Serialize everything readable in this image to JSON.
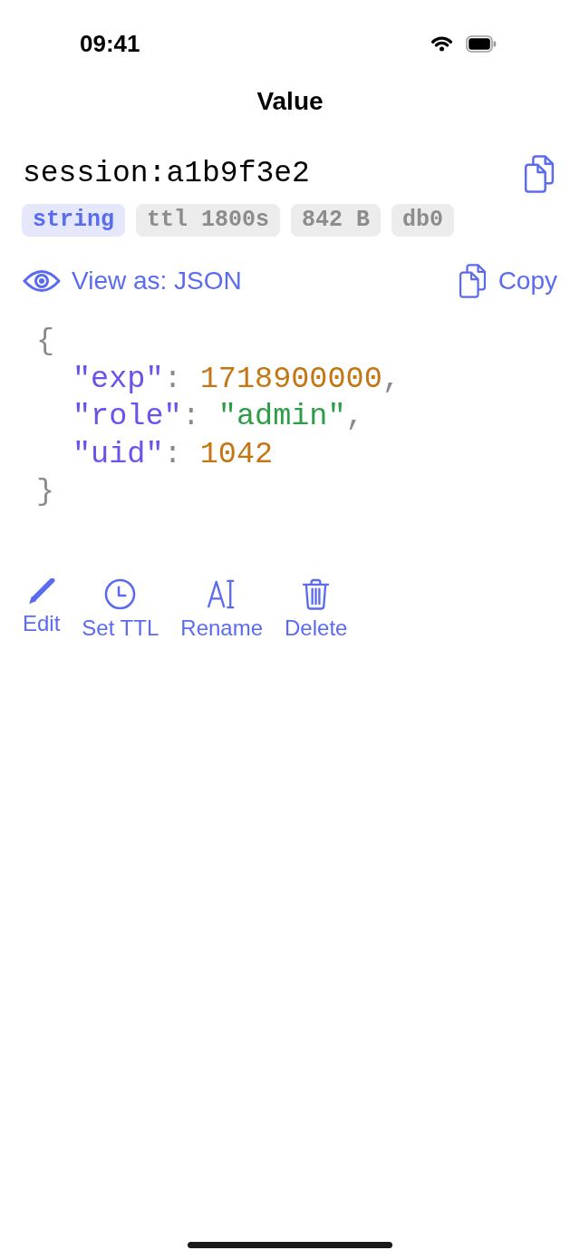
{
  "status_bar": {
    "time": "09:41"
  },
  "nav": {
    "title": "Value"
  },
  "key": {
    "name": "session:a1b9f3e2"
  },
  "tags": [
    {
      "text": "string",
      "kind": "type"
    },
    {
      "text": "ttl 1800s",
      "kind": "meta"
    },
    {
      "text": "842 B",
      "kind": "meta"
    },
    {
      "text": "db0",
      "kind": "meta"
    }
  ],
  "view_bar": {
    "view_label": "View as: JSON",
    "copy_label": "Copy"
  },
  "json_view": {
    "open": "{",
    "entries": [
      {
        "tokens": [
          {
            "kind": "key",
            "text": "\"exp\""
          },
          {
            "kind": "colon",
            "text": ":"
          },
          {
            "kind": "number",
            "text": "1718900000"
          },
          {
            "kind": "comma",
            "text": ","
          }
        ]
      },
      {
        "tokens": [
          {
            "kind": "key",
            "text": "\"role\""
          },
          {
            "kind": "colon",
            "text": ":"
          },
          {
            "kind": "string",
            "text": "\"admin\""
          },
          {
            "kind": "comma",
            "text": ","
          }
        ]
      },
      {
        "tokens": [
          {
            "kind": "key",
            "text": "\"uid\""
          },
          {
            "kind": "colon",
            "text": ":"
          },
          {
            "kind": "number",
            "text": "1042"
          }
        ]
      }
    ],
    "close": "}"
  },
  "actions": [
    {
      "label": "Edit",
      "kind": "edit"
    },
    {
      "label": "Set TTL",
      "kind": "ttl"
    },
    {
      "label": "Rename",
      "kind": "rename"
    },
    {
      "label": "Delete",
      "kind": "delete"
    }
  ]
}
